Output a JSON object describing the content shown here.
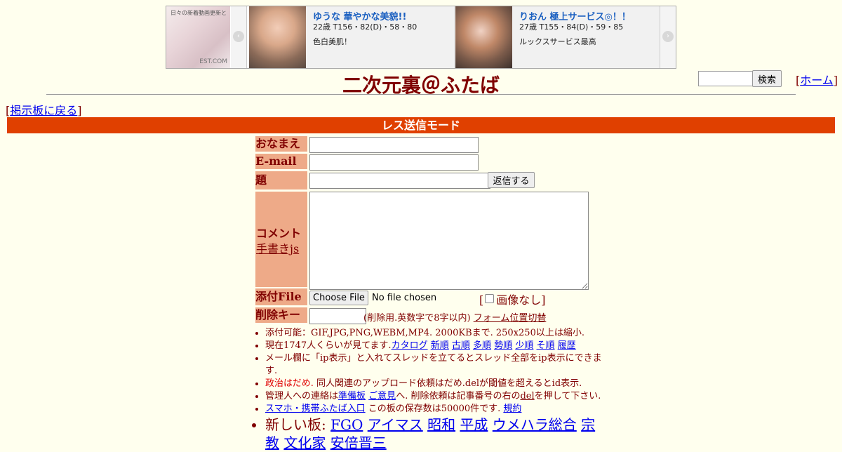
{
  "ad": {
    "left_text": "日々の新着動画更新と",
    "left_text2": "EST.COM",
    "prev_icon": "‹",
    "next_icon": "›",
    "cards": [
      {
        "name": "ゆうな 華やかな美貌!!",
        "spec": "22歳 T156・82(D)・58・80",
        "desc": "色白美肌！"
      },
      {
        "name": "りおん 極上サービス◎！！",
        "spec": "27歳 T155・84(D)・59・85",
        "desc": "ルックスサービス最高"
      }
    ]
  },
  "header": {
    "title": "二次元裏＠ふたば",
    "search_button": "検索",
    "home_prefix": "[",
    "home_link": "ホーム",
    "home_suffix": "]"
  },
  "nav": {
    "back_prefix": "[",
    "back_link": "掲示板に戻る",
    "back_suffix": "]"
  },
  "mode_bar": "レス送信モード",
  "form": {
    "name_label": "おなまえ",
    "email_label": "E-mail",
    "subject_label": "題　名",
    "reply_button": "返信する",
    "comment_label": "コメント",
    "handwrite_link": "手書きjs",
    "file_label": "添付File",
    "choose_file_button": "Choose File",
    "no_file_text": "No file chosen",
    "noimage_prefix": "[",
    "noimage_label": "画像なし",
    "noimage_suffix": "]",
    "delkey_label": "削除キー",
    "delkey_note": "(削除用.英数字で8字以内)",
    "form_toggle_link": "フォーム位置切替"
  },
  "notes": {
    "line1": "添付可能：GIF,JPG,PNG,WEBM,MP4. 2000KBまで. 250x250以上は縮小.",
    "line2_text": "現在1747人くらいが見てます.",
    "line2_links": [
      "カタログ",
      "新順",
      "古順",
      "多順",
      "勢順",
      "少順",
      "そ順",
      "履歴"
    ],
    "line3": "メール欄に「ip表示」と入れてスレッドを立てるとスレッド全部をip表示にできます.",
    "line4_red": "政治はだめ.",
    "line4_rest": " 同人関連のアップロード依頼はだめ.delが閾値を超えるとid表示.",
    "line5_a": "管理人への連絡は",
    "line5_link1": "準備板",
    "line5_link2": "ご意見",
    "line5_b": "へ. 削除依頼は記事番号の右の",
    "line5_del": "del",
    "line5_c": "を押して下さい.",
    "line6_link": "スマホ・携帯ふたば入口",
    "line6_text": " この板の保存数は50000件です. ",
    "line6_link2": "規約",
    "boards_label": "新しい板: ",
    "boards": [
      "FGO",
      "アイマス",
      "昭和",
      "平成",
      "ウメハラ総合",
      "宗教",
      "文化家",
      "安倍晋三"
    ]
  }
}
